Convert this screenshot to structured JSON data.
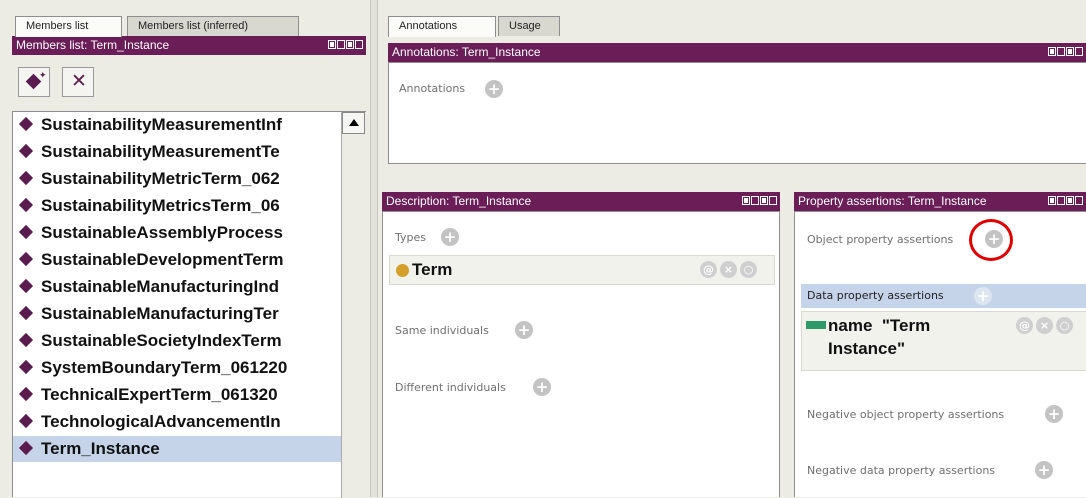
{
  "left": {
    "tabs": [
      "Members list",
      "Members list (inferred)"
    ],
    "header": "Members list: Term_Instance",
    "items": [
      "SustainabilityMeasurementInf",
      "SustainabilityMeasurementTe",
      "SustainabilityMetricTerm_062",
      "SustainabilityMetricsTerm_06",
      "SustainableAssemblyProcess",
      "SustainableDevelopmentTerm",
      "SustainableManufacturingInd",
      "SustainableManufacturingTer",
      "SustainableSocietyIndexTerm",
      "SystemBoundaryTerm_061220",
      "TechnicalExpertTerm_061320",
      "TechnologicalAdvancementIn",
      "Term_Instance"
    ],
    "selected_index": 12
  },
  "right": {
    "tabs": [
      "Annotations",
      "Usage"
    ],
    "annotations_header": "Annotations: Term_Instance",
    "annotations_label": "Annotations",
    "description_header": "Description: Term_Instance",
    "types_label": "Types",
    "type_value": "Term",
    "same_label": "Same individuals",
    "different_label": "Different individuals",
    "property_header": "Property assertions: Term_Instance",
    "object_prop_label": "Object property assertions",
    "data_prop_label": "Data property assertions",
    "data_prop_value_line1": "name  \"Term",
    "data_prop_value_line2": "Instance\"",
    "neg_object_label": "Negative object property assertions",
    "neg_data_label": "Negative data property assertions"
  },
  "icons": {
    "add": "+",
    "at": "@",
    "remove": "×",
    "edit": "○"
  },
  "colors": {
    "header": "#6a1d57",
    "selected_row": "#c5d4e8",
    "highlight_circle": "#e00000",
    "class_dot": "#d4a02a",
    "data_prop_bar": "#2e9a6a"
  }
}
